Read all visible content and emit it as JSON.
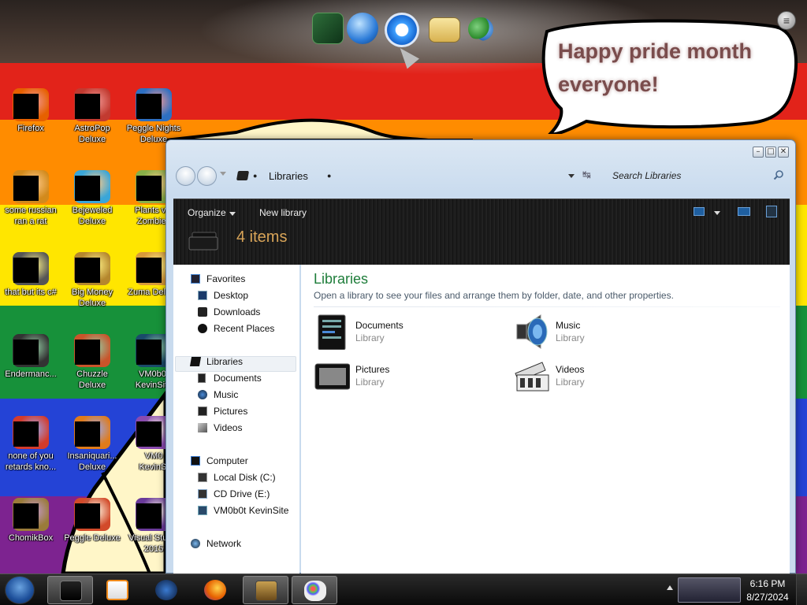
{
  "desktop": {
    "speech_bubble": "Happy pride month everyone!",
    "icons": [
      {
        "label": "Firefox",
        "icon": "firefox-icon",
        "color": "#e66000"
      },
      {
        "label": "AstroPop\nDeluxe",
        "icon": "astropop-icon",
        "color": "#c23a30"
      },
      {
        "label": "Peggle Nights\nDeluxe",
        "icon": "peggle-nights-icon",
        "color": "#2d6fc2"
      },
      {
        "label": "some russian\nran a rat",
        "icon": "russian-rat-icon",
        "color": "#d28a1c"
      },
      {
        "label": "Bejeweled\nDeluxe",
        "icon": "bejeweled-icon",
        "color": "#3aa6d8"
      },
      {
        "label": "Plants vs.\nZombies",
        "icon": "pvz-icon",
        "color": "#88b048"
      },
      {
        "label": "that but its c#",
        "icon": "file-icon",
        "color": "#555555"
      },
      {
        "label": "Big Money\nDeluxe",
        "icon": "big-money-icon",
        "color": "#b5872d"
      },
      {
        "label": "Zuma Deluxe",
        "icon": "zuma-icon",
        "color": "#d89a3a"
      },
      {
        "label": "Endermanc...",
        "icon": "terminal-icon",
        "color": "#333333"
      },
      {
        "label": "Chuzzle\nDeluxe",
        "icon": "chuzzle-icon",
        "color": "#c9542a"
      },
      {
        "label": "VM0b0t\nKevinSite",
        "icon": "vm-icon",
        "color": "#1a4a6a"
      },
      {
        "label": "none of you\nretards kno...",
        "icon": "chrome-icon",
        "color": "#d33b2c"
      },
      {
        "label": "Insaniquari...\nDeluxe",
        "icon": "insaniquarium-icon",
        "color": "#e07b1a"
      },
      {
        "label": "VM0\nKevinSi",
        "icon": "vm-icon",
        "color": "#8a4ab0"
      },
      {
        "label": "ChomikBox",
        "icon": "chomikbox-icon",
        "color": "#9a7b3a"
      },
      {
        "label": "Peggle Deluxe",
        "icon": "peggle-icon",
        "color": "#d24a2a"
      },
      {
        "label": "Visual Studio\n2015",
        "icon": "visual-studio-icon",
        "color": "#6a3a9a"
      }
    ]
  },
  "window": {
    "address": "Libraries",
    "search_placeholder": "Search Libraries",
    "caption": {
      "minimize": "–",
      "maximize": "□",
      "close": "✕"
    },
    "toolbar": {
      "organize": "Organize",
      "new_library": "New library"
    },
    "item_count": "4 items",
    "nav": [
      {
        "label": "Favorites",
        "icon": "favorites-icon",
        "level": 0
      },
      {
        "label": "Desktop",
        "icon": "desktop-icon",
        "level": 1
      },
      {
        "label": "Downloads",
        "icon": "downloads-icon",
        "level": 1
      },
      {
        "label": "Recent Places",
        "icon": "recent-places-icon",
        "level": 1
      },
      {
        "label": "Libraries",
        "icon": "libraries-icon",
        "level": 0
      },
      {
        "label": "Documents",
        "icon": "documents-icon",
        "level": 1
      },
      {
        "label": "Music",
        "icon": "music-icon",
        "level": 1
      },
      {
        "label": "Pictures",
        "icon": "pictures-icon",
        "level": 1
      },
      {
        "label": "Videos",
        "icon": "videos-icon",
        "level": 1
      },
      {
        "label": "Computer",
        "icon": "computer-icon",
        "level": 0
      },
      {
        "label": "Local Disk (C:)",
        "icon": "local-disk-icon",
        "level": 1
      },
      {
        "label": "CD Drive (E:)",
        "icon": "cd-drive-icon",
        "level": 1
      },
      {
        "label": "VM0b0t KevinSite",
        "icon": "network-drive-icon",
        "level": 1
      },
      {
        "label": "Network",
        "icon": "network-icon",
        "level": 0
      }
    ],
    "content": {
      "title": "Libraries",
      "subtitle": "Open a library to see your files and arrange them by folder, date, and other properties.",
      "libraries": [
        {
          "name": "Documents",
          "type": "Library",
          "icon": "documents-library-icon"
        },
        {
          "name": "Music",
          "type": "Library",
          "icon": "music-library-icon"
        },
        {
          "name": "Pictures",
          "type": "Library",
          "icon": "pictures-library-icon"
        },
        {
          "name": "Videos",
          "type": "Library",
          "icon": "videos-library-icon"
        }
      ]
    }
  },
  "taskbar": {
    "time": "6:16 PM",
    "date": "8/27/2024",
    "buttons": [
      {
        "icon": "explorer-icon",
        "active": true
      },
      {
        "icon": "media-player-icon",
        "active": false
      },
      {
        "icon": "browser-icon",
        "active": false
      },
      {
        "icon": "firefox-icon",
        "active": false
      },
      {
        "icon": "chomikbox-icon",
        "active": true
      },
      {
        "icon": "paint-icon",
        "active": true
      }
    ]
  }
}
